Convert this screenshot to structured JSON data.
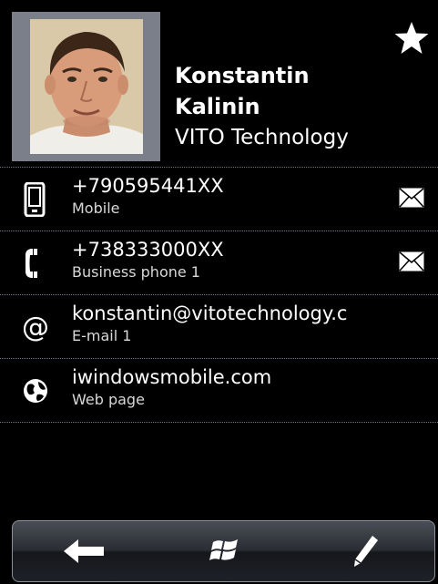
{
  "contact": {
    "first_name": "Konstantin",
    "last_name": "Kalinin",
    "company": "VITO Technology",
    "favorite_icon": "star-icon"
  },
  "rows": [
    {
      "icon": "mobile-phone-icon",
      "value": "+790595441XX",
      "label": "Mobile",
      "action_icon": "envelope-icon"
    },
    {
      "icon": "business-phone-icon",
      "value": "+738333000XX",
      "label": "Business phone 1",
      "action_icon": "envelope-icon"
    },
    {
      "icon": "at-sign-icon",
      "value": "konstantin@vitotechnology.c",
      "label": "E-mail 1"
    },
    {
      "icon": "globe-icon",
      "value": "iwindowsmobile.com",
      "label": "Web page"
    }
  ],
  "toolbar": {
    "buttons": [
      "back-arrow-icon",
      "windows-logo-icon",
      "pencil-edit-icon"
    ]
  },
  "colors": {
    "background": "#000000",
    "divider": "#6f7a8c",
    "photo_frame": "#7a7f8a",
    "text": "#ffffff"
  }
}
